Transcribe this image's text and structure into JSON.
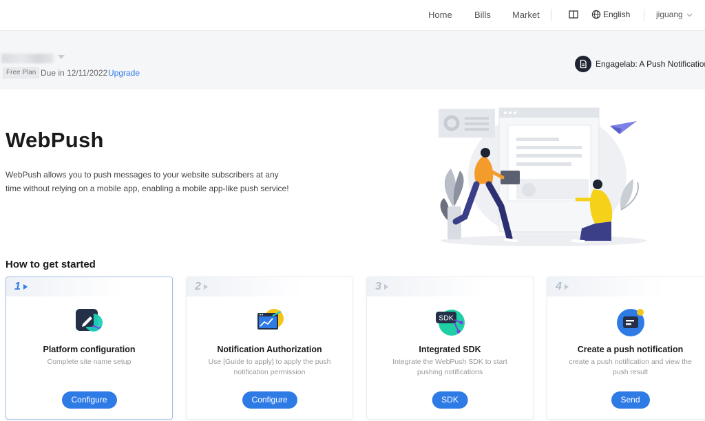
{
  "nav": {
    "links": [
      "Home",
      "Bills",
      "Market"
    ],
    "language": "English",
    "user": "jiguang"
  },
  "account": {
    "plan": "Free Plan",
    "due": "Due in 12/11/2022",
    "upgrade": "Upgrade",
    "app_name": "Engagelab: A Push Notification"
  },
  "hero": {
    "title": "WebPush",
    "description": "WebPush allows you to push messages to your website subscribers at any time without relying on a mobile app, enabling a mobile app-like push service!"
  },
  "steps": {
    "title": "How to get started",
    "cards": [
      {
        "num": "1",
        "title": "Platform configuration",
        "desc": "Complete site name setup",
        "button": "Configure",
        "icon": "edit-icon"
      },
      {
        "num": "2",
        "title": "Notification Authorization",
        "desc": "Use [Guide to apply] to apply the push notification permission",
        "button": "Configure",
        "icon": "chart-window-icon"
      },
      {
        "num": "3",
        "title": "Integrated SDK",
        "desc": "Integrate the WebPush SDK to start pushing notifications",
        "button": "SDK",
        "icon": "sdk-icon",
        "icon_text": "SDK"
      },
      {
        "num": "4",
        "title": "Create a push notification",
        "desc": "create a push notification and view the push result",
        "button": "Send",
        "icon": "message-icon"
      }
    ]
  },
  "colors": {
    "accent": "#2f7be6",
    "active_border": "#9fc0ea"
  }
}
